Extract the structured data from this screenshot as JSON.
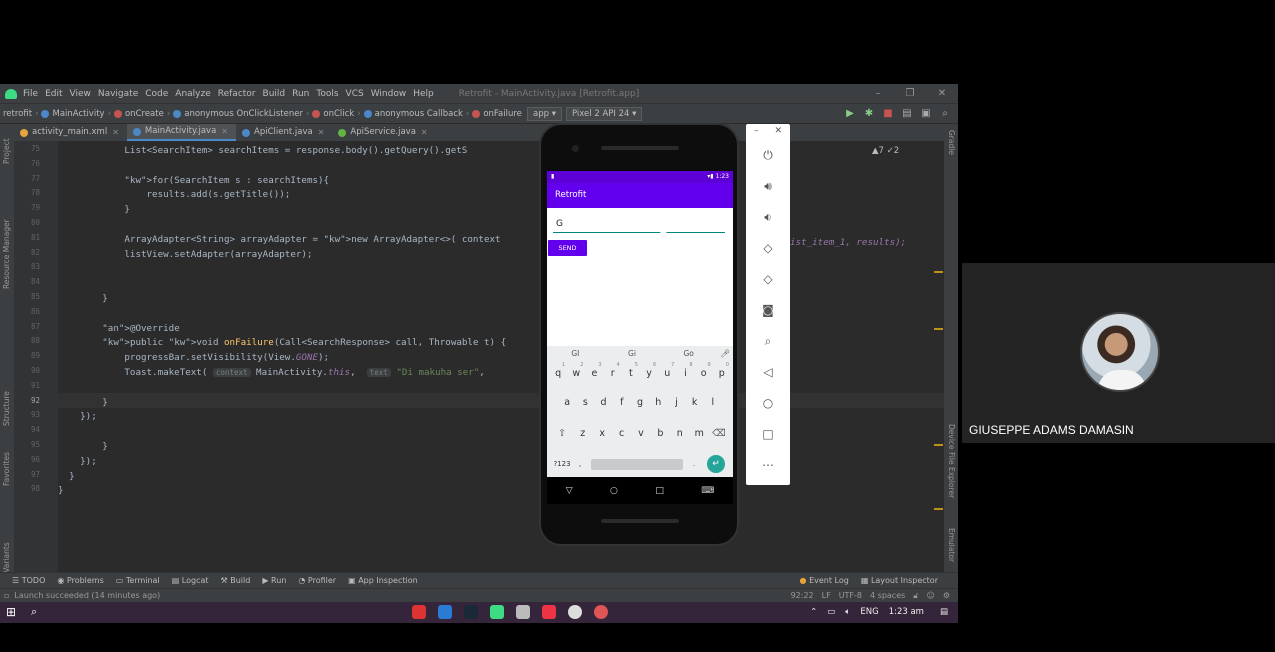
{
  "ide": {
    "menu": [
      "File",
      "Edit",
      "View",
      "Navigate",
      "Code",
      "Analyze",
      "Refactor",
      "Build",
      "Run",
      "Tools",
      "VCS",
      "Window",
      "Help"
    ],
    "window_title": "Retrofit - MainActivity.java [Retrofit.app]",
    "breadcrumbs": [
      "retrofit",
      "MainActivity",
      "onCreate",
      "anonymous OnClickListener",
      "onClick",
      "anonymous Callback",
      "onFailure"
    ],
    "run_config": "app",
    "device": "Pixel 2 API 24",
    "tabs": [
      "activity_main.xml",
      "MainActivity.java",
      "ApiClient.java",
      "ApiService.java"
    ],
    "active_tab": "MainActivity.java",
    "warnings": "▲7 ✓2",
    "left_tools": [
      "Project",
      "Resource Manager",
      "Structure",
      "Favorites",
      "Build Variants"
    ],
    "right_tools": [
      "Gradle",
      "Device File Explorer",
      "Emulator"
    ],
    "line_numbers": [
      "75",
      "76",
      "77",
      "78",
      "79",
      "80",
      "81",
      "82",
      "83",
      "84",
      "85",
      "86",
      "87",
      "88",
      "89",
      "90",
      "91",
      "92",
      "93",
      "94",
      "95",
      "96",
      "97",
      "98"
    ],
    "current_line": "92",
    "code": [
      "            List<SearchItem> searchItems = response.body().getQuery().getS",
      "",
      "            for(SearchItem s : searchItems){",
      "                results.add(s.getTitle());",
      "            }",
      "",
      "            ArrayAdapter<String> arrayAdapter = new ArrayAdapter<>( context",
      "            listView.setAdapter(arrayAdapter);",
      "",
      "",
      "        }",
      "",
      "        @Override",
      "        public void onFailure(Call<SearchResponse> call, Throwable t) {",
      "            progressBar.setVisibility(View.GONE);",
      "            Toast.makeText( context MainActivity.this,  text \"Di makuha ser\",",
      "",
      "        }",
      "    });",
      "",
      "        }",
      "    });",
      "  }",
      "}"
    ],
    "code_right_tail": "ist_item_1, results);",
    "bottom_tools": [
      "TODO",
      "Problems",
      "Terminal",
      "Logcat",
      "Build",
      "Run",
      "Profiler",
      "App Inspection"
    ],
    "bottom_right_tools": [
      "Event Log",
      "Layout Inspector"
    ],
    "status_message": "Launch succeeded (14 minutes ago)",
    "status_right": [
      "92:22",
      "LF",
      "UTF-8",
      "4 spaces"
    ]
  },
  "emulator": {
    "status_time": "1:23",
    "app_title": "Retrofit",
    "input_value": "G",
    "send_label": "SEND",
    "suggestions": [
      "GI",
      "Gi",
      "Go"
    ],
    "keys_row1": [
      "q",
      "w",
      "e",
      "r",
      "t",
      "y",
      "u",
      "i",
      "o",
      "p"
    ],
    "keys_row1_nums": [
      "1",
      "2",
      "3",
      "4",
      "5",
      "6",
      "7",
      "8",
      "9",
      "0"
    ],
    "keys_row2": [
      "a",
      "s",
      "d",
      "f",
      "g",
      "h",
      "j",
      "k",
      "l"
    ],
    "keys_row3": [
      "z",
      "x",
      "c",
      "v",
      "b",
      "n",
      "m"
    ],
    "key_symbols": "?123",
    "key_comma": ",",
    "key_period": "."
  },
  "taskbar": {
    "lang": "ENG",
    "time": "1:23 am"
  },
  "participant": {
    "name": "GIUSEPPE ADAMS DAMASIN"
  },
  "colors": {
    "ide_bg": "#2b2b2b",
    "app_primary": "#6200ee",
    "accent_teal": "#00897b"
  }
}
